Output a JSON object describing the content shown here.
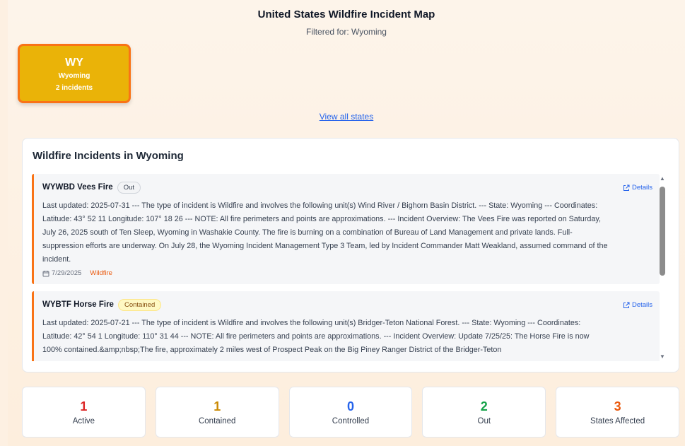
{
  "header": {
    "title": "United States Wildfire Incident Map",
    "subtitle": "Filtered for: Wyoming"
  },
  "state_tile": {
    "abbr": "WY",
    "name": "Wyoming",
    "count": "2 incidents"
  },
  "view_all_label": "View all states",
  "incidents_section": {
    "title": "Wildfire Incidents in Wyoming",
    "items": [
      {
        "name": "WYWBD Vees Fire",
        "status": "Out",
        "details_label": "Details",
        "text": "Last updated: 2025-07-31 --- The type of incident is Wildfire and involves the following unit(s) Wind River / Bighorn Basin District. --- State: Wyoming --- Coordinates: Latitude: 43° 52 11 Longitude: 107° 18 26 --- NOTE: All fire perimeters and points are approximations. --- Incident Overview: The Vees Fire was reported on Saturday, July 26, 2025 south of Ten Sleep, Wyoming in Washakie County. The fire is burning on a combination of Bureau of Land Management and private lands. Full-suppression efforts are underway. On July 28, the Wyoming Incident Management Type 3 Team, led by Incident Commander Matt Weakland, assumed command of the incident.",
        "date": "7/29/2025",
        "type": "Wildfire"
      },
      {
        "name": "WYBTF Horse Fire",
        "status": "Contained",
        "details_label": "Details",
        "text": "Last updated: 2025-07-21 --- The type of incident is Wildfire and involves the following unit(s) Bridger-Teton National Forest. --- State: Wyoming --- Coordinates: Latitude: 42° 54 1 Longitude: 110° 31 44 --- NOTE: All fire perimeters and points are approximations. --- Incident Overview: Update 7/25/25: The Horse Fire is now 100% contained.&amp;nbsp;The fire, approximately 2 miles west of Prospect Peak on the Big Piney Ranger District of the Bridger-Teton",
        "date": "",
        "type": ""
      }
    ]
  },
  "stats": [
    {
      "value": "1",
      "label": "Active",
      "color": "#dc2626"
    },
    {
      "value": "1",
      "label": "Contained",
      "color": "#ca8a04"
    },
    {
      "value": "0",
      "label": "Controlled",
      "color": "#2563eb"
    },
    {
      "value": "2",
      "label": "Out",
      "color": "#16a34a"
    },
    {
      "value": "3",
      "label": "States Affected",
      "color": "#ea580c"
    }
  ],
  "colors": {
    "accent_orange": "#f97316",
    "tile_yellow": "#eab308",
    "link_blue": "#2563eb"
  }
}
